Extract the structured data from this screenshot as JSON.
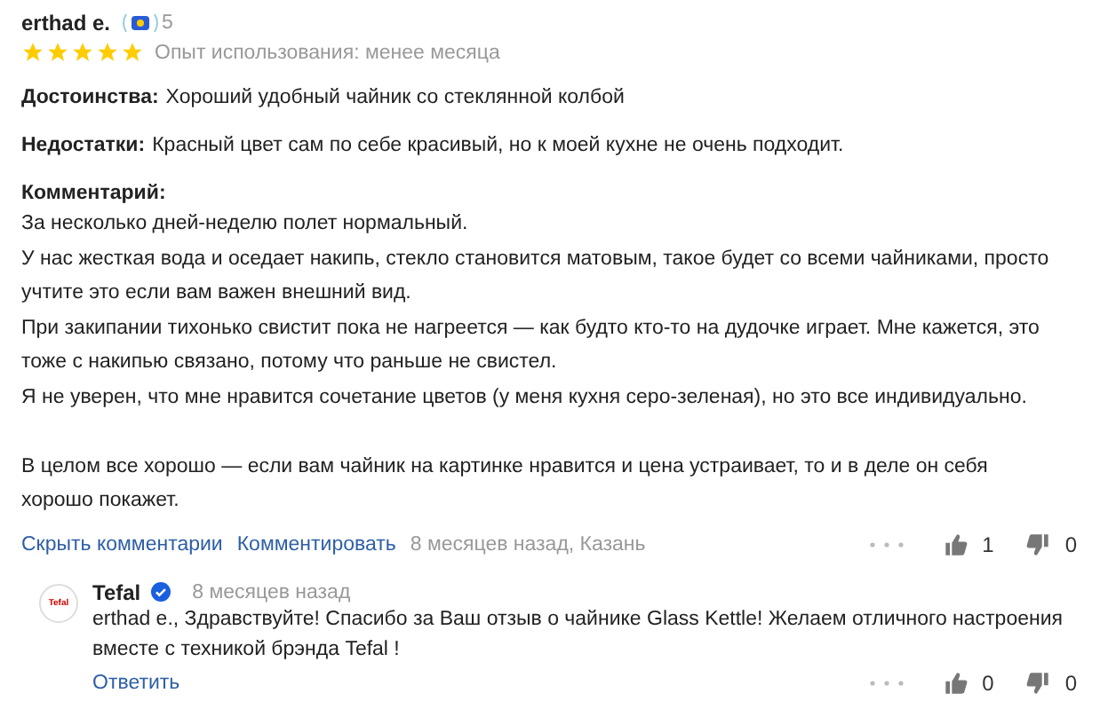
{
  "review": {
    "author": "erthad e.",
    "badge_count": "5",
    "stars": 5,
    "experience": "Опыт использования: менее месяца",
    "pros": {
      "label": "Достоинства:",
      "text": "Хороший удобный чайник со стеклянной колбой"
    },
    "cons": {
      "label": "Недостатки:",
      "text": "Красный цвет сам по себе красивый, но к моей кухне не очень подходит."
    },
    "comment": {
      "label": "Комментарий:",
      "paragraphs": [
        [
          "За несколько дней-неделю полет нормальный.",
          "У нас жесткая вода и оседает накипь, стекло становится матовым, такое будет со всеми чайниками, просто",
          "учтите это если вам важен внешний вид.",
          "При закипании тихонько свистит пока не нагреется — как будто кто-то на дудочке играет. Мне кажется, это",
          "тоже с накипью связано, потому что раньше не свистел.",
          "Я не уверен, что мне нравится сочетание цветов (у меня кухня серо-зеленая), но это все индивидуально."
        ],
        [
          "В целом все хорошо — если вам чайник на картинке нравится и цена устраивает, то и в деле он себя",
          "хорошо покажет."
        ]
      ]
    },
    "actions": [
      "Скрыть комментарии",
      "Комментировать"
    ],
    "meta": "8 месяцев назад, Казань",
    "likes": "1",
    "dislikes": "0"
  },
  "reply": {
    "avatar_text": "Tefal",
    "author": "Tefal",
    "verified": true,
    "time": "8 месяцев назад",
    "lines": [
      "erthad e., Здравствуйте! Спасибо за Ваш отзыв о чайнике Glass Kettle! Желаем отличного настроения",
      "вместе с техникой брэнда Tefal !"
    ],
    "action": "Ответить",
    "likes": "0",
    "dislikes": "0"
  }
}
